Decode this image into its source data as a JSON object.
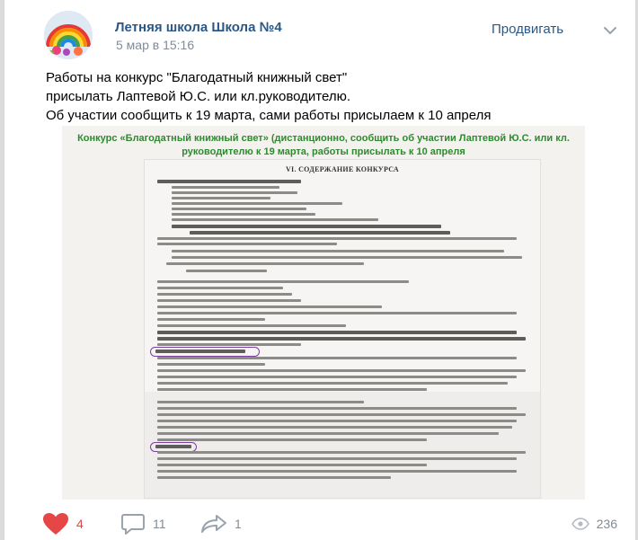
{
  "post": {
    "author": "Летняя школа Школа №4",
    "time": "5 мар в 15:16",
    "promote_label": "Продвигать",
    "text_lines": [
      "Работы на конкурс \"Благодатный книжный свет\"",
      "присылать Лаптевой Ю.С. или кл.руководителю.",
      "Об участии сообщить к 19 марта, сами работы присылаем к 10 апреля"
    ]
  },
  "image": {
    "banner_line1": "Конкурс «Благодатный книжный свет» (дистанционно, сообщить об участии  Лаптевой Ю.С. или кл.",
    "banner_line2": "руководителю к 19 марта, работы присылать к 10 апреля",
    "doc_title": "VI. СОДЕРЖАНИЕ КОНКУРСА"
  },
  "footer": {
    "likes": "4",
    "comments": "11",
    "shares": "1",
    "views": "236"
  },
  "colors": {
    "accent": "#2a5885",
    "like": "#e64646",
    "muted": "#818c99",
    "banner_green": "#2e8a2e"
  }
}
